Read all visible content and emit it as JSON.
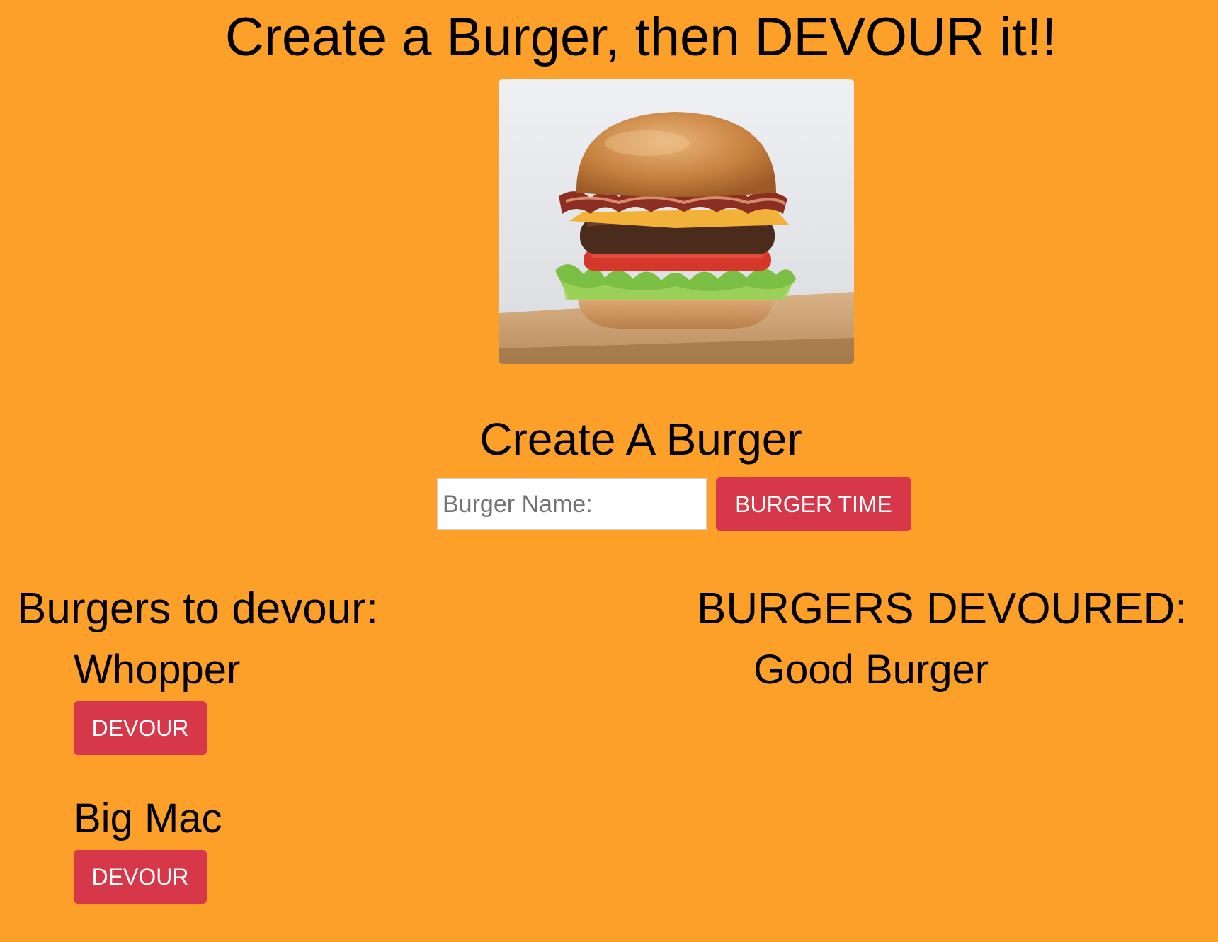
{
  "page": {
    "title": "Create a Burger, then DEVOUR it!!",
    "background_color": "#fda02a"
  },
  "hero_image": {
    "subject": "bacon cheeseburger photo"
  },
  "create_form": {
    "heading": "Create A Burger",
    "input_placeholder": "Burger Name:",
    "input_value": "",
    "submit_label": "BURGER TIME",
    "button_color": "#d73849"
  },
  "to_devour": {
    "heading": "Burgers to devour:",
    "items": [
      {
        "name": "Whopper",
        "button_label": "DEVOUR"
      },
      {
        "name": "Big Mac",
        "button_label": "DEVOUR"
      }
    ]
  },
  "devoured": {
    "heading": "BURGERS DEVOURED:",
    "items": [
      {
        "name": "Good Burger"
      }
    ]
  }
}
